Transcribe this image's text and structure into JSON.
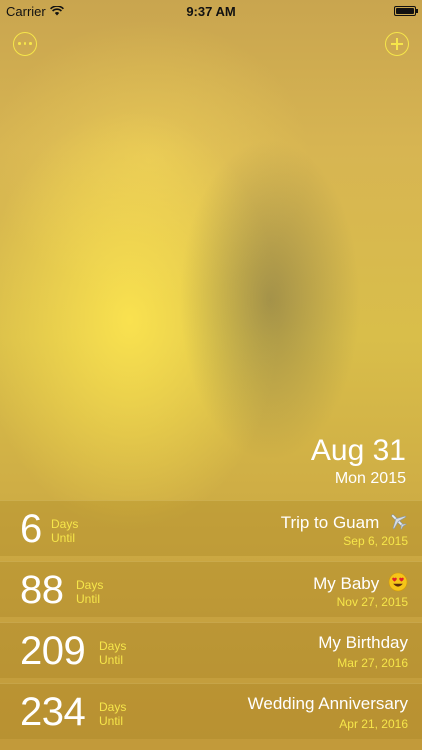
{
  "status_bar": {
    "carrier": "Carrier",
    "time": "9:37 AM"
  },
  "today": {
    "day": "Aug 31",
    "weekday_year": "Mon 2015"
  },
  "events": [
    {
      "count": "6",
      "unit_top": "Days",
      "unit_bottom": "Until",
      "title": "Trip to Guam",
      "emoji": "airplane-icon",
      "date": "Sep 6, 2015"
    },
    {
      "count": "88",
      "unit_top": "Days",
      "unit_bottom": "Until",
      "title": "My Baby",
      "emoji": "heart-eyes-emoji-icon",
      "date": "Nov 27, 2015"
    },
    {
      "count": "209",
      "unit_top": "Days",
      "unit_bottom": "Until",
      "title": "My Birthday",
      "emoji": "",
      "date": "Mar 27, 2016"
    },
    {
      "count": "234",
      "unit_top": "Days",
      "unit_bottom": "Until",
      "title": "Wedding Anniversary",
      "emoji": "",
      "date": "Apr 21, 2016"
    }
  ],
  "colors": {
    "accent": "#f6e64a",
    "text": "#ffffff",
    "background": "#d5b64c"
  }
}
